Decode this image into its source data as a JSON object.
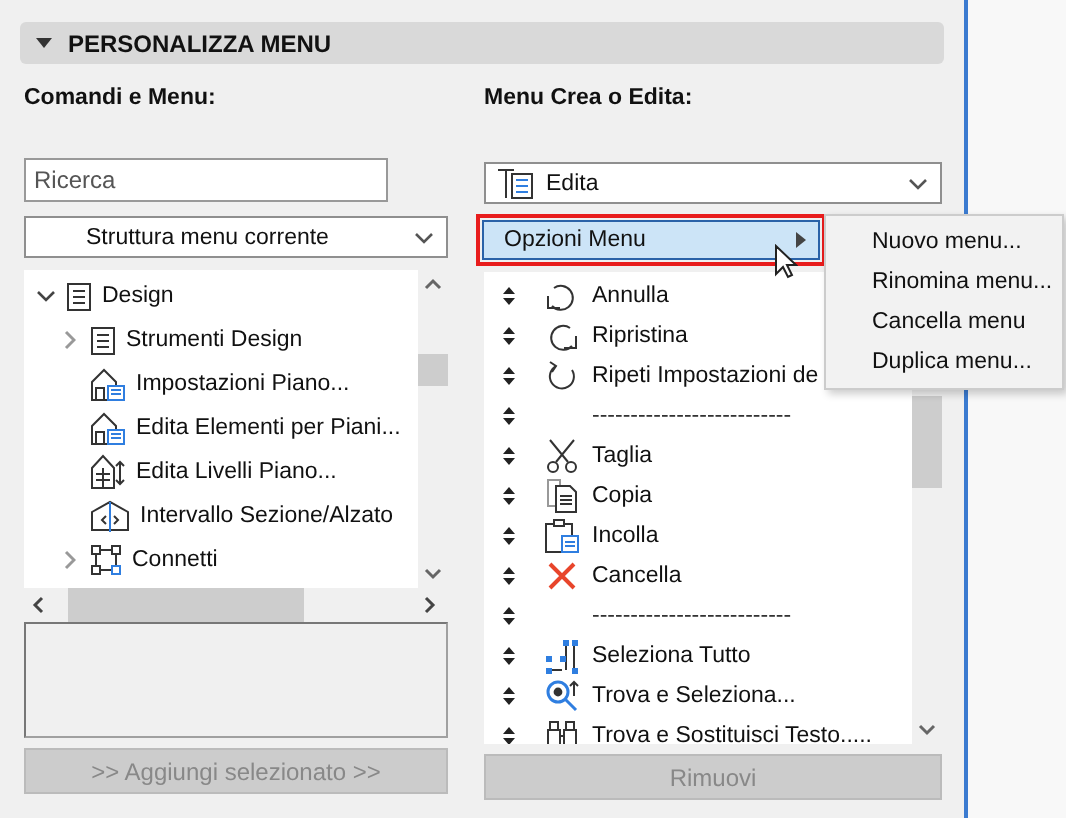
{
  "section": {
    "title": "PERSONALIZZA MENU",
    "expanded": true
  },
  "left": {
    "label": "Comandi e Menu:",
    "search": {
      "placeholder": "Ricerca"
    },
    "view_select": {
      "value": "Struttura menu corrente"
    },
    "tree": [
      {
        "label": "Design",
        "expanded": true,
        "children": [
          {
            "label": "Strumenti Design",
            "expanded": false
          },
          {
            "label": "Impostazioni Piano..."
          },
          {
            "label": "Edita Elementi per Piani..."
          },
          {
            "label": "Edita Livelli Piano..."
          },
          {
            "label": "Intervallo Sezione/Alzato"
          },
          {
            "label": "Connetti",
            "expanded": false
          }
        ]
      }
    ],
    "add_button": {
      "label": ">> Aggiungi selezionato >>",
      "disabled": true
    }
  },
  "right": {
    "label": "Menu Crea o Edita:",
    "menu_select": {
      "value": "Edita"
    },
    "options_row": {
      "label": "Opzioni Menu",
      "selected": true
    },
    "options_submenu": [
      "Nuovo menu...",
      "Rinomina menu...",
      "Cancella menu",
      "Duplica menu..."
    ],
    "items": [
      {
        "kind": "command",
        "label": "Annulla"
      },
      {
        "kind": "command",
        "label": "Ripristina"
      },
      {
        "kind": "command",
        "label": "Ripeti Impostazioni de"
      },
      {
        "kind": "separator",
        "label": "--------------------------"
      },
      {
        "kind": "command",
        "label": "Taglia"
      },
      {
        "kind": "command",
        "label": "Copia"
      },
      {
        "kind": "command",
        "label": "Incolla"
      },
      {
        "kind": "command",
        "label": "Cancella"
      },
      {
        "kind": "separator",
        "label": "--------------------------"
      },
      {
        "kind": "command",
        "label": "Seleziona Tutto"
      },
      {
        "kind": "command",
        "label": "Trova e Seleziona..."
      },
      {
        "kind": "command",
        "label": "Trova e Sostituisci Testo....."
      }
    ],
    "remove_button": {
      "label": "Rimuovi",
      "disabled": true
    }
  }
}
